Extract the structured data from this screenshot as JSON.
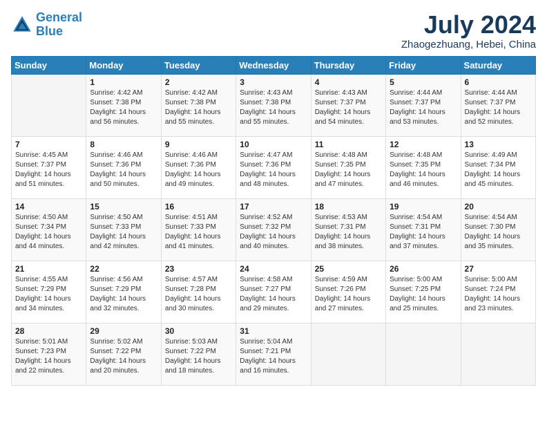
{
  "logo": {
    "line1": "General",
    "line2": "Blue"
  },
  "title": "July 2024",
  "location": "Zhaogezhuang, Hebei, China",
  "days_of_week": [
    "Sunday",
    "Monday",
    "Tuesday",
    "Wednesday",
    "Thursday",
    "Friday",
    "Saturday"
  ],
  "weeks": [
    [
      {
        "num": "",
        "info": ""
      },
      {
        "num": "1",
        "info": "Sunrise: 4:42 AM\nSunset: 7:38 PM\nDaylight: 14 hours\nand 56 minutes."
      },
      {
        "num": "2",
        "info": "Sunrise: 4:42 AM\nSunset: 7:38 PM\nDaylight: 14 hours\nand 55 minutes."
      },
      {
        "num": "3",
        "info": "Sunrise: 4:43 AM\nSunset: 7:38 PM\nDaylight: 14 hours\nand 55 minutes."
      },
      {
        "num": "4",
        "info": "Sunrise: 4:43 AM\nSunset: 7:37 PM\nDaylight: 14 hours\nand 54 minutes."
      },
      {
        "num": "5",
        "info": "Sunrise: 4:44 AM\nSunset: 7:37 PM\nDaylight: 14 hours\nand 53 minutes."
      },
      {
        "num": "6",
        "info": "Sunrise: 4:44 AM\nSunset: 7:37 PM\nDaylight: 14 hours\nand 52 minutes."
      }
    ],
    [
      {
        "num": "7",
        "info": "Sunrise: 4:45 AM\nSunset: 7:37 PM\nDaylight: 14 hours\nand 51 minutes."
      },
      {
        "num": "8",
        "info": "Sunrise: 4:46 AM\nSunset: 7:36 PM\nDaylight: 14 hours\nand 50 minutes."
      },
      {
        "num": "9",
        "info": "Sunrise: 4:46 AM\nSunset: 7:36 PM\nDaylight: 14 hours\nand 49 minutes."
      },
      {
        "num": "10",
        "info": "Sunrise: 4:47 AM\nSunset: 7:36 PM\nDaylight: 14 hours\nand 48 minutes."
      },
      {
        "num": "11",
        "info": "Sunrise: 4:48 AM\nSunset: 7:35 PM\nDaylight: 14 hours\nand 47 minutes."
      },
      {
        "num": "12",
        "info": "Sunrise: 4:48 AM\nSunset: 7:35 PM\nDaylight: 14 hours\nand 46 minutes."
      },
      {
        "num": "13",
        "info": "Sunrise: 4:49 AM\nSunset: 7:34 PM\nDaylight: 14 hours\nand 45 minutes."
      }
    ],
    [
      {
        "num": "14",
        "info": "Sunrise: 4:50 AM\nSunset: 7:34 PM\nDaylight: 14 hours\nand 44 minutes."
      },
      {
        "num": "15",
        "info": "Sunrise: 4:50 AM\nSunset: 7:33 PM\nDaylight: 14 hours\nand 42 minutes."
      },
      {
        "num": "16",
        "info": "Sunrise: 4:51 AM\nSunset: 7:33 PM\nDaylight: 14 hours\nand 41 minutes."
      },
      {
        "num": "17",
        "info": "Sunrise: 4:52 AM\nSunset: 7:32 PM\nDaylight: 14 hours\nand 40 minutes."
      },
      {
        "num": "18",
        "info": "Sunrise: 4:53 AM\nSunset: 7:31 PM\nDaylight: 14 hours\nand 38 minutes."
      },
      {
        "num": "19",
        "info": "Sunrise: 4:54 AM\nSunset: 7:31 PM\nDaylight: 14 hours\nand 37 minutes."
      },
      {
        "num": "20",
        "info": "Sunrise: 4:54 AM\nSunset: 7:30 PM\nDaylight: 14 hours\nand 35 minutes."
      }
    ],
    [
      {
        "num": "21",
        "info": "Sunrise: 4:55 AM\nSunset: 7:29 PM\nDaylight: 14 hours\nand 34 minutes."
      },
      {
        "num": "22",
        "info": "Sunrise: 4:56 AM\nSunset: 7:29 PM\nDaylight: 14 hours\nand 32 minutes."
      },
      {
        "num": "23",
        "info": "Sunrise: 4:57 AM\nSunset: 7:28 PM\nDaylight: 14 hours\nand 30 minutes."
      },
      {
        "num": "24",
        "info": "Sunrise: 4:58 AM\nSunset: 7:27 PM\nDaylight: 14 hours\nand 29 minutes."
      },
      {
        "num": "25",
        "info": "Sunrise: 4:59 AM\nSunset: 7:26 PM\nDaylight: 14 hours\nand 27 minutes."
      },
      {
        "num": "26",
        "info": "Sunrise: 5:00 AM\nSunset: 7:25 PM\nDaylight: 14 hours\nand 25 minutes."
      },
      {
        "num": "27",
        "info": "Sunrise: 5:00 AM\nSunset: 7:24 PM\nDaylight: 14 hours\nand 23 minutes."
      }
    ],
    [
      {
        "num": "28",
        "info": "Sunrise: 5:01 AM\nSunset: 7:23 PM\nDaylight: 14 hours\nand 22 minutes."
      },
      {
        "num": "29",
        "info": "Sunrise: 5:02 AM\nSunset: 7:22 PM\nDaylight: 14 hours\nand 20 minutes."
      },
      {
        "num": "30",
        "info": "Sunrise: 5:03 AM\nSunset: 7:22 PM\nDaylight: 14 hours\nand 18 minutes."
      },
      {
        "num": "31",
        "info": "Sunrise: 5:04 AM\nSunset: 7:21 PM\nDaylight: 14 hours\nand 16 minutes."
      },
      {
        "num": "",
        "info": ""
      },
      {
        "num": "",
        "info": ""
      },
      {
        "num": "",
        "info": ""
      }
    ]
  ]
}
